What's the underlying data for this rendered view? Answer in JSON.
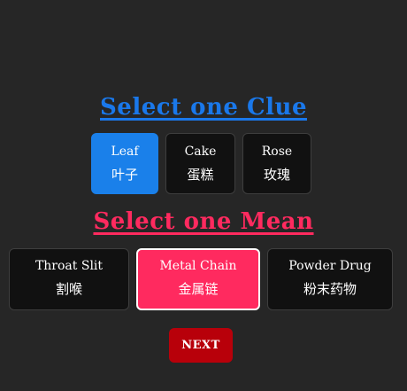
{
  "clue_section": {
    "title": "Select one Clue",
    "color": "#1a78ea",
    "selected_index": 0,
    "options": [
      {
        "en": "Leaf",
        "zh": "叶子"
      },
      {
        "en": "Cake",
        "zh": "蛋糕"
      },
      {
        "en": "Rose",
        "zh": "玫瑰"
      }
    ]
  },
  "mean_section": {
    "title": "Select one Mean",
    "color": "#ff2a5f",
    "selected_index": 1,
    "options": [
      {
        "en": "Throat Slit",
        "zh": "割喉"
      },
      {
        "en": "Metal Chain",
        "zh": "金属链"
      },
      {
        "en": "Powder Drug",
        "zh": "粉末药物"
      }
    ]
  },
  "next_button": {
    "label": "NEXT",
    "color": "#b8000a"
  }
}
